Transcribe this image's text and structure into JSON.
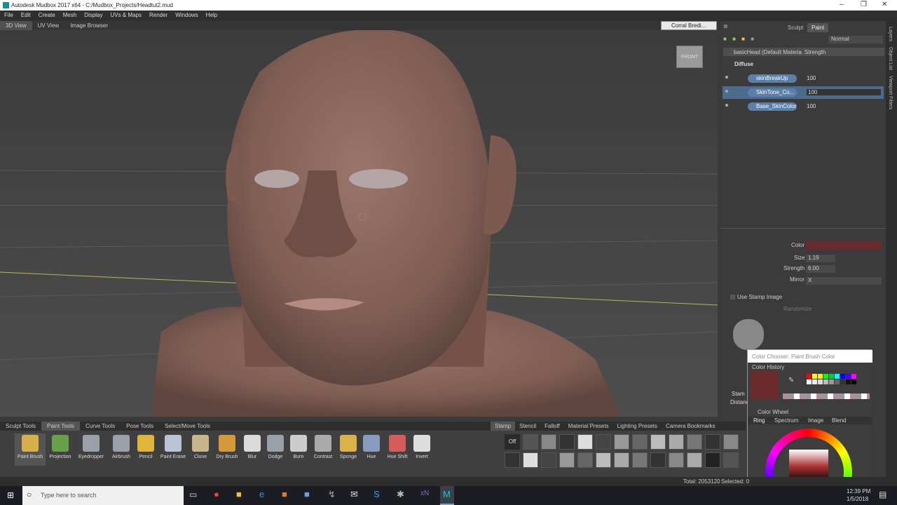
{
  "window": {
    "title": "Autodesk Mudbox 2017 x64 - C:/Mudbox_Projects/Headtut2.mud"
  },
  "menu": [
    "File",
    "Edit",
    "Create",
    "Mesh",
    "Display",
    "UVs & Maps",
    "Render",
    "Windows",
    "Help"
  ],
  "view_tabs": [
    "3D View",
    "UV View",
    "Image Browser"
  ],
  "camera_dropdown": "Corral Bredi...",
  "viewcube_label": "FRONT",
  "panel": {
    "tabs": [
      "Sculpt",
      "Paint"
    ],
    "blend_mode": "Normal",
    "layer_header_left": "basicHead (Default Materia",
    "layer_header_right": "Strength",
    "channel": "Diffuse",
    "layers": [
      {
        "name": "skinBreakUp",
        "value": "100"
      },
      {
        "name": "SkinTone_Co...",
        "value": "100"
      },
      {
        "name": "Base_SkinColor",
        "value": "100"
      }
    ],
    "props": {
      "color_label": "Color",
      "size_label": "Size",
      "size_value": "1.19",
      "strength_label": "Strength",
      "strength_value": "6.00",
      "mirror_label": "Mirror",
      "mirror_value": "X",
      "use_stamp": "Use Stamp Image",
      "randomize": "Randomize",
      "stamp_spacing": "Stam",
      "distance": "Distanc"
    }
  },
  "color_chooser": {
    "title": "Color Chooser: Paint Brush Color",
    "history_label": "Color History",
    "wheel_label": "Color Wheel",
    "wheel_tabs": [
      "Ring",
      "Spectrum",
      "Image",
      "Blend"
    ],
    "current_color": "#6b2b2c"
  },
  "tool_tabs": [
    "Sculpt Tools",
    "Paint Tools",
    "Curve Tools",
    "Pose Tools",
    "Select/Move Tools"
  ],
  "tools": [
    {
      "label": "Paint Brush",
      "icon": "paint-brush-icon",
      "color": "#d7b04a"
    },
    {
      "label": "Projection",
      "icon": "projection-icon",
      "color": "#6aa04c"
    },
    {
      "label": "Eyedropper",
      "icon": "eyedropper-icon",
      "color": "#9aa0aa"
    },
    {
      "label": "Airbrush",
      "icon": "airbrush-icon",
      "color": "#9aa0aa"
    },
    {
      "label": "Pencil",
      "icon": "pencil-icon",
      "color": "#e1b43b"
    },
    {
      "label": "Paint Erase",
      "icon": "paint-erase-icon",
      "color": "#b9c3d6"
    },
    {
      "label": "Clone",
      "icon": "clone-icon",
      "color": "#c9b68a"
    },
    {
      "label": "Dry Brush",
      "icon": "dry-brush-icon",
      "color": "#d49a3a"
    },
    {
      "label": "Blur",
      "icon": "blur-icon",
      "color": "#dadada"
    },
    {
      "label": "Dodge",
      "icon": "dodge-icon",
      "color": "#9aa0aa"
    },
    {
      "label": "Burn",
      "icon": "burn-icon",
      "color": "#cccccc"
    },
    {
      "label": "Contrast",
      "icon": "contrast-icon",
      "color": "#aaaaaa"
    },
    {
      "label": "Sponge",
      "icon": "sponge-icon",
      "color": "#d9b34a"
    },
    {
      "label": "Hue",
      "icon": "hue-icon",
      "color": "#8a9bc0"
    },
    {
      "label": "Hue Shift",
      "icon": "hue-shift-icon",
      "color": "#d65b5b"
    },
    {
      "label": "Invert",
      "icon": "invert-icon",
      "color": "#dddddd"
    }
  ],
  "stamp_tabs": [
    "Stamp",
    "Stencil",
    "Falloff",
    "Material Presets",
    "Lighting Presets",
    "Camera Bookmarks"
  ],
  "stamp_off": "Off",
  "status": {
    "total": "Total: 2053120",
    "selected": "Selected: 0"
  },
  "taskbar": {
    "search_placeholder": "Type here to search",
    "time": "12:39 PM",
    "date": "1/5/2018"
  }
}
